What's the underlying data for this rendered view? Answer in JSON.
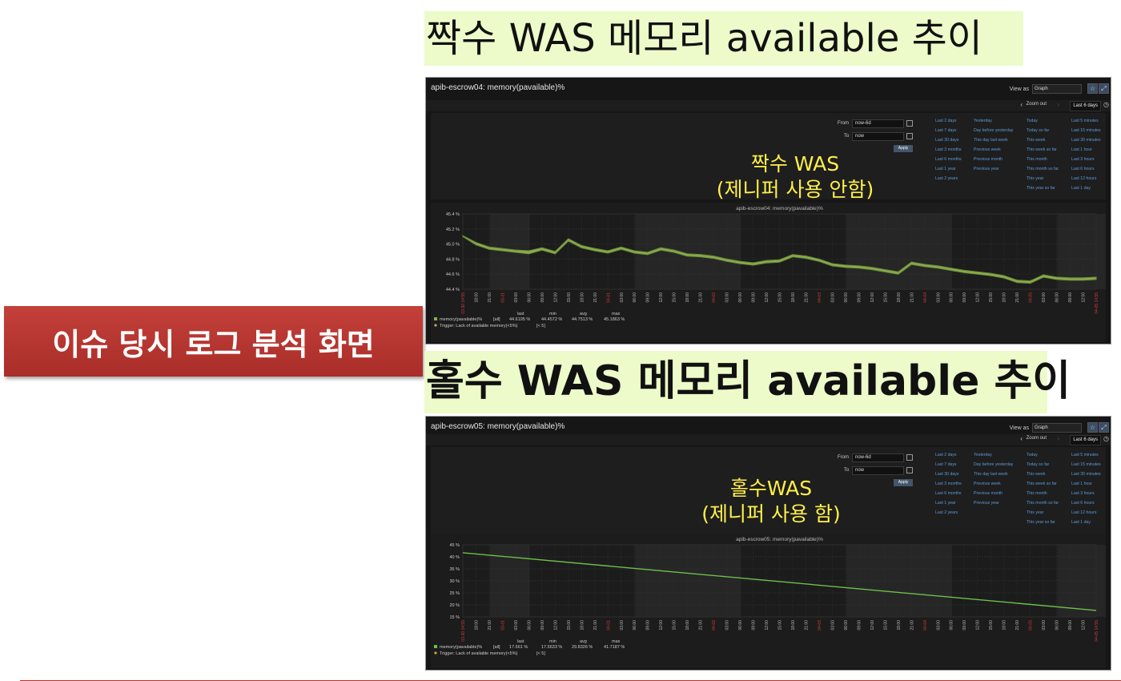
{
  "headings": {
    "even": "짝수 WAS 메모리 available 추이",
    "odd": "홀수 WAS 메모리 available 추이"
  },
  "badge": "이슈 당시 로그 분석 화면",
  "colors": {
    "accent": "#b7312c",
    "heading_bg": "#ecfbc9",
    "series_even": "#8db050",
    "series_odd": "#6cc04a",
    "annotation": "#fff04a",
    "link": "#5c9bd8",
    "date_tick": "#d23c3c"
  },
  "quick_ranges": [
    [
      "Last 2 days",
      "Last 7 days",
      "Last 30 days",
      "Last 3 months",
      "Last 6 months",
      "Last 1 year",
      "Last 2 years"
    ],
    [
      "Yesterday",
      "Day before yesterday",
      "This day last week",
      "Previous week",
      "Previous month",
      "Previous year"
    ],
    [
      "Today",
      "Today so far",
      "This week",
      "This week so far",
      "This month",
      "This month so far",
      "This year",
      "This year so far"
    ],
    [
      "Last 5 minutes",
      "Last 15 minutes",
      "Last 30 minutes",
      "Last 1 hour",
      "Last 3 hours",
      "Last 6 hours",
      "Last 12 hours",
      "Last 1 day"
    ]
  ],
  "panels": [
    {
      "title": "apib-escrow04: memory(pavailable)%",
      "view_as_label": "View as",
      "view_as_value": "Graph",
      "zoom_out": "Zoom out",
      "period": "Last 6 days",
      "from_label": "From",
      "from_value": "now-6d",
      "to_label": "To",
      "to_value": "now",
      "apply": "Apply",
      "annotation_1": "짝수 WAS",
      "annotation_2": "(제니퍼 사용 안함)",
      "chart_data": {
        "type": "line",
        "title": "apib-escrow04: memory(pavailable)%",
        "y_ticks": [
          "45.4 %",
          "45.2 %",
          "45.0 %",
          "44.8 %",
          "44.6 %",
          "44.4 %"
        ],
        "ylim": [
          44.4,
          45.4
        ],
        "x_tick_labels": [
          "03-30 14:55",
          "18:00",
          "21:00",
          "03-31",
          "03:00",
          "06:00",
          "09:00",
          "12:00",
          "15:00",
          "18:00",
          "21:00",
          "04-01",
          "03:00",
          "06:00",
          "09:00",
          "12:00",
          "15:00",
          "18:00",
          "21:00",
          "04-02",
          "03:00",
          "06:00",
          "09:00",
          "12:00",
          "15:00",
          "18:00",
          "21:00",
          "04-03",
          "03:00",
          "06:00",
          "09:00",
          "12:00",
          "15:00",
          "18:00",
          "21:00",
          "04-04",
          "03:00",
          "06:00",
          "09:00",
          "12:00",
          "15:00",
          "18:00",
          "21:00",
          "04-05",
          "03:00",
          "06:00",
          "09:00",
          "12:00",
          "04-05 14:55"
        ],
        "series": [
          {
            "name": "memory(pavailable)%",
            "x": [
              0,
              1,
              2,
              3,
              4,
              5,
              6,
              7,
              8,
              9,
              10,
              11,
              12,
              13,
              14,
              15,
              16,
              17,
              18,
              19,
              20,
              21,
              22,
              23,
              24,
              25,
              26,
              27,
              28,
              29,
              30,
              31,
              32,
              33,
              34,
              35,
              36,
              37,
              38,
              39,
              40,
              41,
              42,
              43,
              44,
              45,
              46,
              47,
              48
            ],
            "values": [
              45.11,
              45.02,
              44.96,
              44.94,
              44.92,
              44.91,
              44.95,
              44.9,
              45.07,
              44.98,
              44.94,
              44.91,
              44.96,
              44.91,
              44.89,
              44.95,
              44.92,
              44.87,
              44.86,
              44.84,
              44.8,
              44.77,
              44.75,
              44.78,
              44.79,
              44.86,
              44.84,
              44.8,
              44.74,
              44.72,
              44.71,
              44.69,
              44.66,
              44.63,
              44.76,
              44.73,
              44.71,
              44.68,
              44.65,
              44.63,
              44.61,
              44.58,
              44.52,
              44.51,
              44.59,
              44.56,
              44.55,
              44.55,
              44.56
            ],
            "values_bottom": [
              45.1,
              44.99,
              44.93,
              44.91,
              44.89,
              44.87,
              44.92,
              44.87,
              45.04,
              44.95,
              44.91,
              44.88,
              44.93,
              44.88,
              44.86,
              44.92,
              44.89,
              44.84,
              44.83,
              44.81,
              44.77,
              44.74,
              44.72,
              44.75,
              44.76,
              44.83,
              44.81,
              44.77,
              44.71,
              44.69,
              44.68,
              44.66,
              44.63,
              44.6,
              44.73,
              44.7,
              44.68,
              44.65,
              44.62,
              44.6,
              44.58,
              44.55,
              44.49,
              44.48,
              44.56,
              44.53,
              44.52,
              44.52,
              44.53
            ]
          }
        ],
        "legend": {
          "series_label": "memory(pavailable)%",
          "scope": "[all]",
          "headers": [
            "last",
            "min",
            "avg",
            "max"
          ],
          "values": [
            "44.6195 %",
            "44.4572 %",
            "44.7513 %",
            "45.1863 %"
          ],
          "trigger": "Trigger: Lack of available memory(<5%)",
          "trigger_cond": "[< 5]"
        }
      }
    },
    {
      "title": "apib-escrow05: memory(pavailable)%",
      "view_as_label": "View as",
      "view_as_value": "Graph",
      "zoom_out": "Zoom out",
      "period": "Last 6 days",
      "from_label": "From",
      "from_value": "now-6d",
      "to_label": "To",
      "to_value": "now",
      "apply": "Apply",
      "annotation_1": "홀수WAS",
      "annotation_2": "(제니퍼 사용 함)",
      "chart_data": {
        "type": "line",
        "title": "apib-escrow05: memory(pavailable)%",
        "y_ticks": [
          "45 %",
          "40 %",
          "35 %",
          "30 %",
          "25 %",
          "20 %",
          "15 %"
        ],
        "ylim": [
          15,
          45
        ],
        "x_tick_labels": [
          "03-30 14:55",
          "18:00",
          "21:00",
          "03-31",
          "03:00",
          "06:00",
          "09:00",
          "12:00",
          "15:00",
          "18:00",
          "21:00",
          "04-01",
          "03:00",
          "06:00",
          "09:00",
          "12:00",
          "15:00",
          "18:00",
          "21:00",
          "04-02",
          "03:00",
          "06:00",
          "09:00",
          "12:00",
          "15:00",
          "18:00",
          "21:00",
          "04-03",
          "03:00",
          "06:00",
          "09:00",
          "12:00",
          "15:00",
          "18:00",
          "21:00",
          "04-04",
          "03:00",
          "06:00",
          "09:00",
          "12:00",
          "15:00",
          "18:00",
          "21:00",
          "04-05",
          "03:00",
          "06:00",
          "09:00",
          "12:00",
          "04-05 14:55"
        ],
        "series": [
          {
            "name": "memory(pavailable)%",
            "x": [
              0,
              48
            ],
            "values": [
              41.7,
              17.7
            ]
          }
        ],
        "legend": {
          "series_label": "memory(pavailable)%",
          "scope": "[all]",
          "headers": [
            "last",
            "min",
            "avg",
            "max"
          ],
          "values": [
            "17.661 %",
            "17.5633 %",
            "29.8326 %",
            "41.7187 %"
          ],
          "trigger": "Trigger: Lack of available memory(<5%)",
          "trigger_cond": "[< 5]"
        }
      }
    }
  ]
}
